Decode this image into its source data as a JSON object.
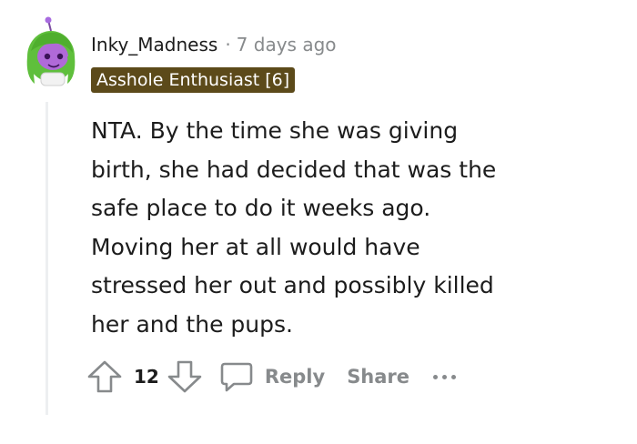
{
  "comment": {
    "author": "Inky_Madness",
    "separator": "·",
    "timestamp": "7 days ago",
    "flair": "Asshole Enthusiast [6]",
    "body_lines": [
      "NTA. By the time she was giving",
      "birth, she had decided that was the",
      "safe place to do it weeks ago.",
      "Moving her at all would have",
      "stressed her out and possibly killed",
      "her and the pups."
    ],
    "vote_count": "12",
    "reply_label": "Reply",
    "share_label": "Share"
  },
  "icons": {
    "avatar": "snoo-avatar-green-hair",
    "upvote": "upvote-arrow-icon",
    "downvote": "downvote-arrow-icon",
    "reply": "speech-bubble-icon",
    "more": "more-options-icon"
  },
  "colors": {
    "flair_bg": "#5c4a1a",
    "muted_text": "#878a8c",
    "text": "#1c1c1c",
    "avatar_hair": "#5fbf3c",
    "avatar_face": "#b06ad8"
  }
}
